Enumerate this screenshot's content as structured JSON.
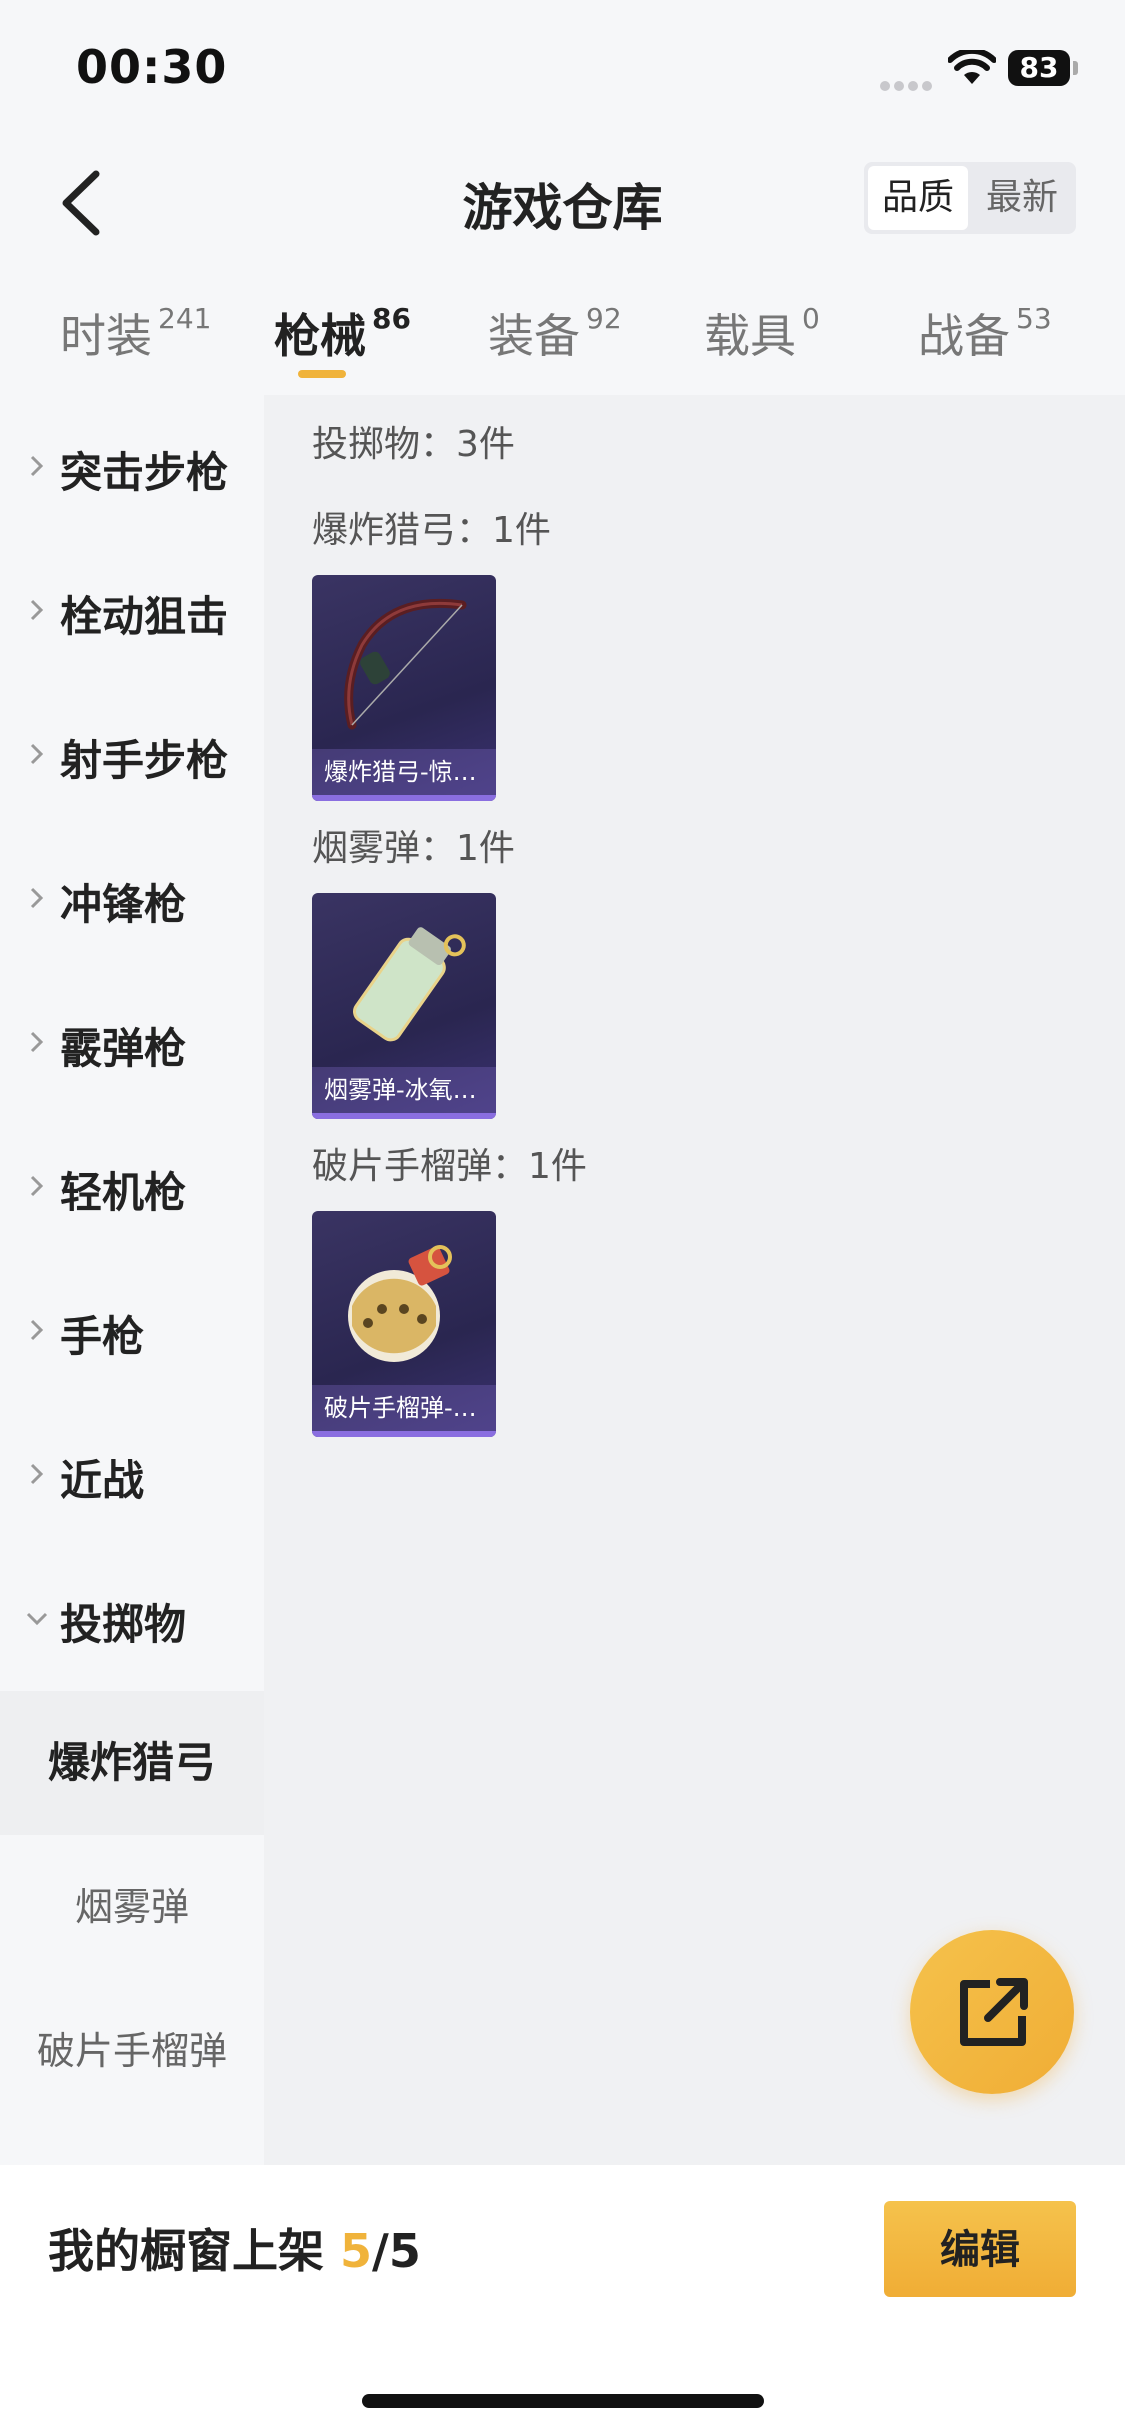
{
  "status": {
    "time": "00:30",
    "battery": "83"
  },
  "header": {
    "title": "游戏仓库",
    "sort_quality": "品质",
    "sort_newest": "最新"
  },
  "tabs": [
    {
      "label": "时装",
      "count": "241"
    },
    {
      "label": "枪械",
      "count": "86"
    },
    {
      "label": "装备",
      "count": "92"
    },
    {
      "label": "载具",
      "count": "0"
    },
    {
      "label": "战备",
      "count": "53"
    }
  ],
  "sidebar": {
    "categories": [
      "突击步枪",
      "栓动狙击",
      "射手步枪",
      "冲锋枪",
      "霰弹枪",
      "轻机枪",
      "手枪",
      "近战",
      "投掷物"
    ],
    "subcategories": [
      "爆炸猎弓",
      "烟雾弹",
      "破片手榴弹"
    ]
  },
  "content": {
    "summary": "投掷物：3件",
    "sections": [
      {
        "label": "爆炸猎弓：1件",
        "card_caption": "爆炸猎弓-惊…"
      },
      {
        "label": "烟雾弹：1件",
        "card_caption": "烟雾弹-冰氧…"
      },
      {
        "label": "破片手榴弹：1件",
        "card_caption": "破片手榴弹-…"
      }
    ]
  },
  "bottom": {
    "shelf_label": "我的橱窗上架 ",
    "shelf_count": "5",
    "shelf_total": "/5",
    "edit_label": "编辑"
  },
  "colors": {
    "accent": "#f0b33b",
    "card_bg": "#2a2650",
    "card_bar": "#8a6ee0"
  }
}
